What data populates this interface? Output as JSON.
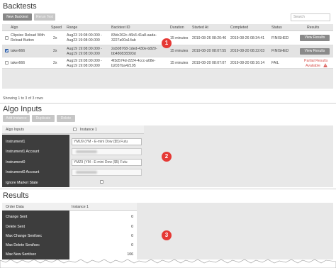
{
  "backtests": {
    "title": "Backtests",
    "new_button": "New Backtest",
    "rerun_button": "Rerun Test",
    "search_placeholder": "Search",
    "columns": [
      "Algo",
      "Speed",
      "Range",
      "Backtest ID",
      "Duration",
      "Started At",
      "Completed",
      "Status",
      "Results"
    ],
    "rows": [
      {
        "checked": false,
        "algo": [
          "Clipsize Reload With",
          "Reload Button"
        ],
        "speed": "2x",
        "range": [
          "Aug23 19:08:00.000 -",
          "Aug23 19:08:00.000"
        ],
        "id": [
          "83dc262c-46b3-41a8-aada-",
          "3227a00a14ab"
        ],
        "duration": "15 minutes",
        "started": "2019-08-26 08:20:46",
        "completed": "2019-08-26 08:34:41",
        "status": "FINISHED",
        "result": "View Results"
      },
      {
        "checked": true,
        "algo": [
          "taker666"
        ],
        "speed": "2x",
        "range": [
          "Aug19 19:08:00.000 -",
          "Aug19 19:08:00.000"
        ],
        "id": [
          "2a508768-1ded-430e-b820-",
          "bb480838393d"
        ],
        "duration": "15 minutes",
        "started": "2019-08-20 08:07:55",
        "completed": "2019-08-20 08:22:03",
        "status": "FINISHED",
        "result": "View Results"
      },
      {
        "checked": false,
        "algo": [
          "taker666"
        ],
        "speed": "2x",
        "range": [
          "Aug19 19:08:00.000 -",
          "Aug19 19:08:00.000"
        ],
        "id": [
          "4f3d574d-2224-4ccc-a08e-",
          "b2037ba42195"
        ],
        "duration": "15 minutes",
        "started": "2019-08-20 08:07:07",
        "completed": "2019-08-20 08:16:14",
        "status": "FAIL",
        "result": [
          "Partial Results",
          "Available"
        ]
      }
    ],
    "footer": "Showing 1 to 3 of 3 rows"
  },
  "algo_inputs": {
    "title": "Algo Inputs",
    "buttons": [
      "Add Instance",
      "Duplicate",
      "Delete"
    ],
    "header_label": "Algo Inputs",
    "instance_label": "Instance 1",
    "rows": [
      {
        "label": "Instrument1",
        "value": "YMU9 (YM - E-mini Dow ($5) Futu"
      },
      {
        "label": "Instrument1 Account",
        "value": ""
      },
      {
        "label": "Instrument0",
        "value": "YMZ9 (YM - E-mini Dow ($5) Futu"
      },
      {
        "label": "Instrument0 Account",
        "value": ""
      },
      {
        "label": "Ignore Market State",
        "value": ""
      }
    ]
  },
  "results": {
    "title": "Results",
    "header_label": "Order Data",
    "instance_label": "Instance 1",
    "rows": [
      {
        "label": "Change Sent",
        "value": "0"
      },
      {
        "label": "Delete Sent",
        "value": "0"
      },
      {
        "label": "Max Change Sent/sec",
        "value": "0"
      },
      {
        "label": "Max Delete Sent/sec",
        "value": "0"
      },
      {
        "label": "Max New Sent/sec",
        "value": "106"
      }
    ]
  },
  "badges": [
    "1",
    "2",
    "3"
  ],
  "colors": {
    "badge": "#e53935",
    "fail_text": "#d9534f",
    "label_column": "#3d3d3d",
    "checkbox_checked": "#3b73c8"
  }
}
